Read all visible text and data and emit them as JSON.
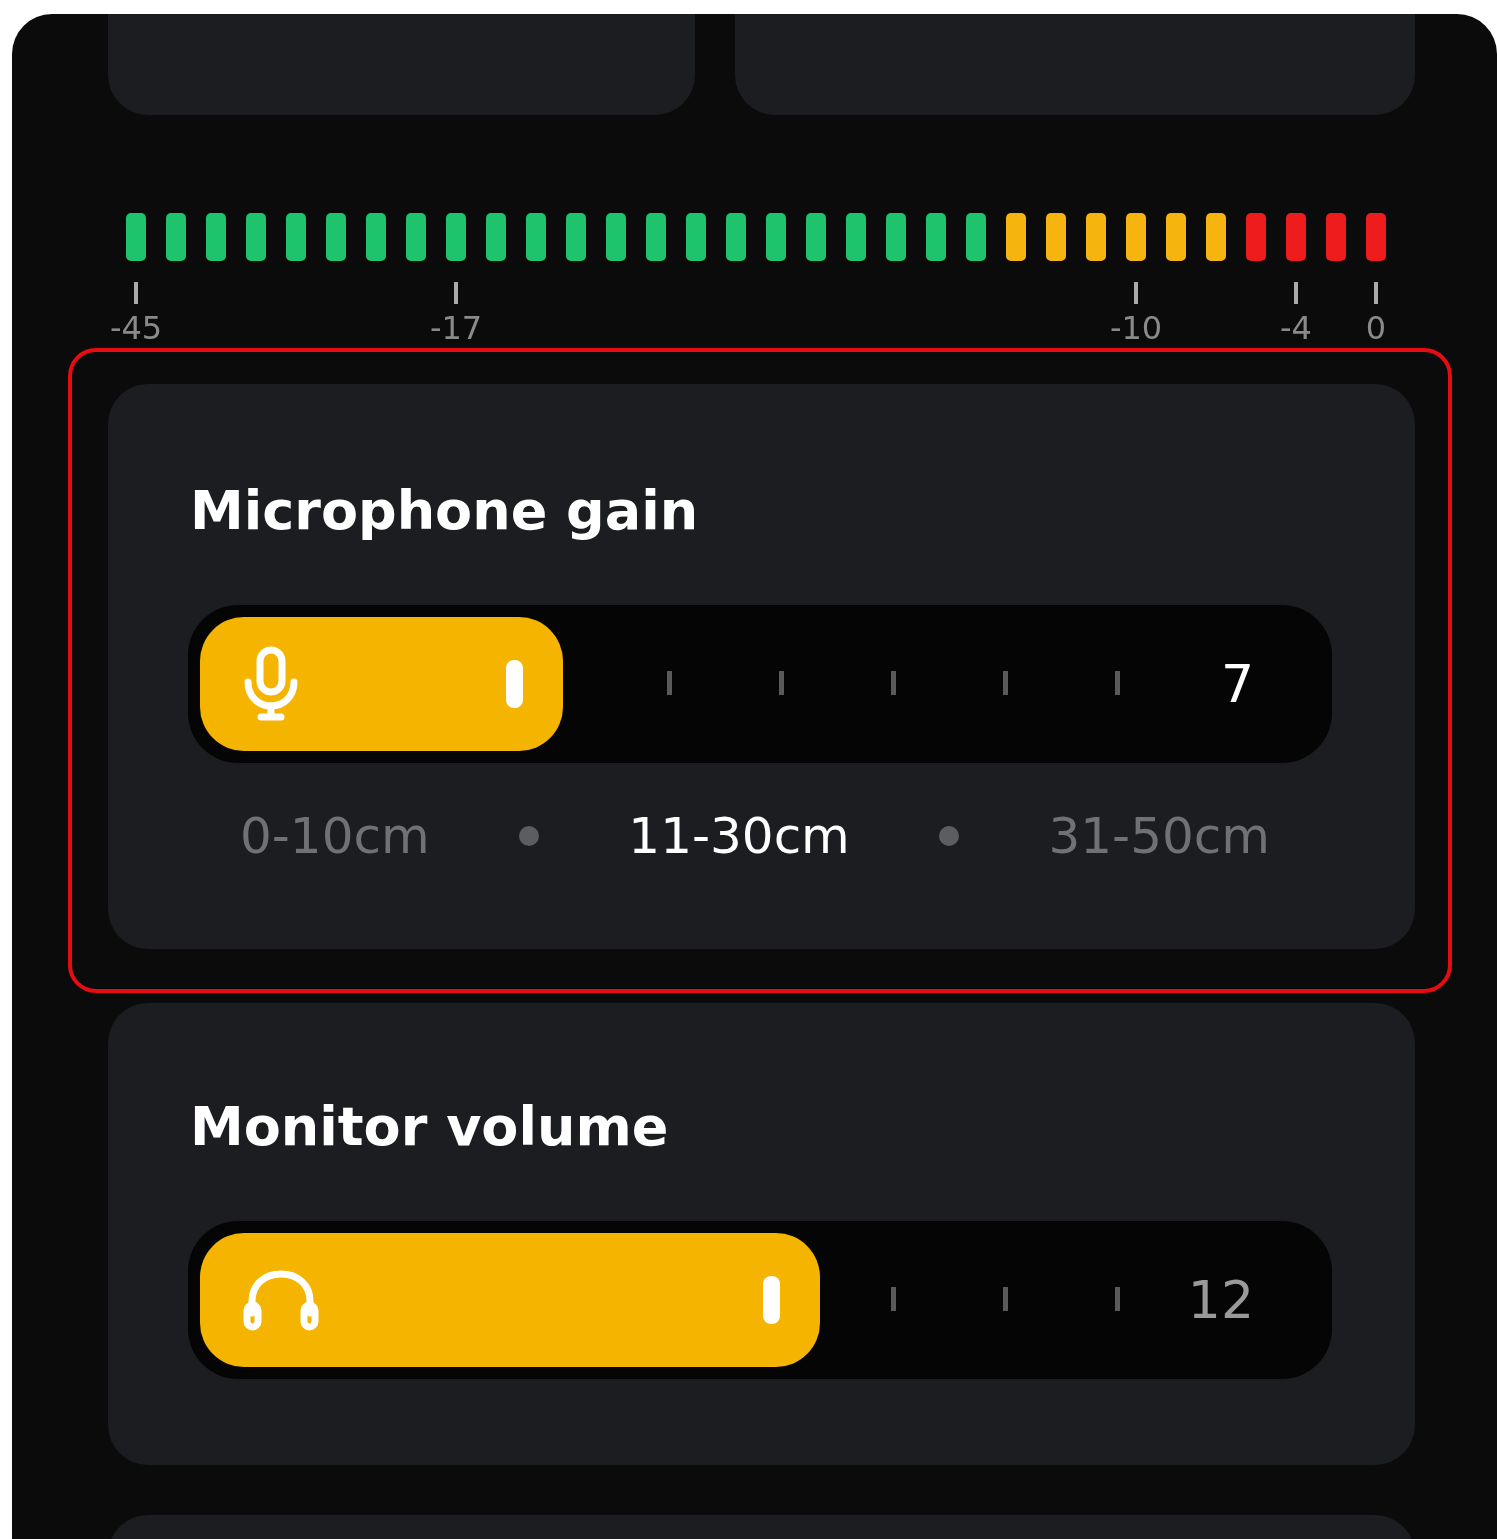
{
  "level_meter": {
    "segments": [
      {
        "color": "#1ec46b",
        "label": "-45"
      },
      {
        "color": "#1ec46b"
      },
      {
        "color": "#1ec46b"
      },
      {
        "color": "#1ec46b"
      },
      {
        "color": "#1ec46b"
      },
      {
        "color": "#1ec46b"
      },
      {
        "color": "#1ec46b"
      },
      {
        "color": "#1ec46b"
      },
      {
        "color": "#1ec46b",
        "label": "-17"
      },
      {
        "color": "#1ec46b"
      },
      {
        "color": "#1ec46b"
      },
      {
        "color": "#1ec46b"
      },
      {
        "color": "#1ec46b"
      },
      {
        "color": "#1ec46b"
      },
      {
        "color": "#1ec46b"
      },
      {
        "color": "#1ec46b"
      },
      {
        "color": "#1ec46b"
      },
      {
        "color": "#1ec46b"
      },
      {
        "color": "#1ec46b"
      },
      {
        "color": "#1ec46b"
      },
      {
        "color": "#1ec46b"
      },
      {
        "color": "#1ec46b"
      },
      {
        "color": "#f6b40e"
      },
      {
        "color": "#f6b40e"
      },
      {
        "color": "#f6b40e"
      },
      {
        "color": "#f6b40e",
        "label": "-10"
      },
      {
        "color": "#f6b40e"
      },
      {
        "color": "#f6b40e"
      },
      {
        "color": "#ee1c1c"
      },
      {
        "color": "#ee1c1c",
        "label": "-4"
      },
      {
        "color": "#ee1c1c"
      },
      {
        "color": "#ee1c1c",
        "label": "0"
      }
    ]
  },
  "controls": [
    {
      "kind": "gain",
      "title": "Microphone gain",
      "level": 0.285,
      "value": "7",
      "value_highlighted": true,
      "distances": [
        {
          "label": "0-10cm",
          "selected": false
        },
        {
          "label": "11-30cm",
          "selected": true
        },
        {
          "label": "31-50cm",
          "selected": false
        }
      ]
    },
    {
      "kind": "monitor",
      "title": "Monitor volume",
      "level": 0.51,
      "value": "12",
      "value_highlighted": false
    }
  ]
}
